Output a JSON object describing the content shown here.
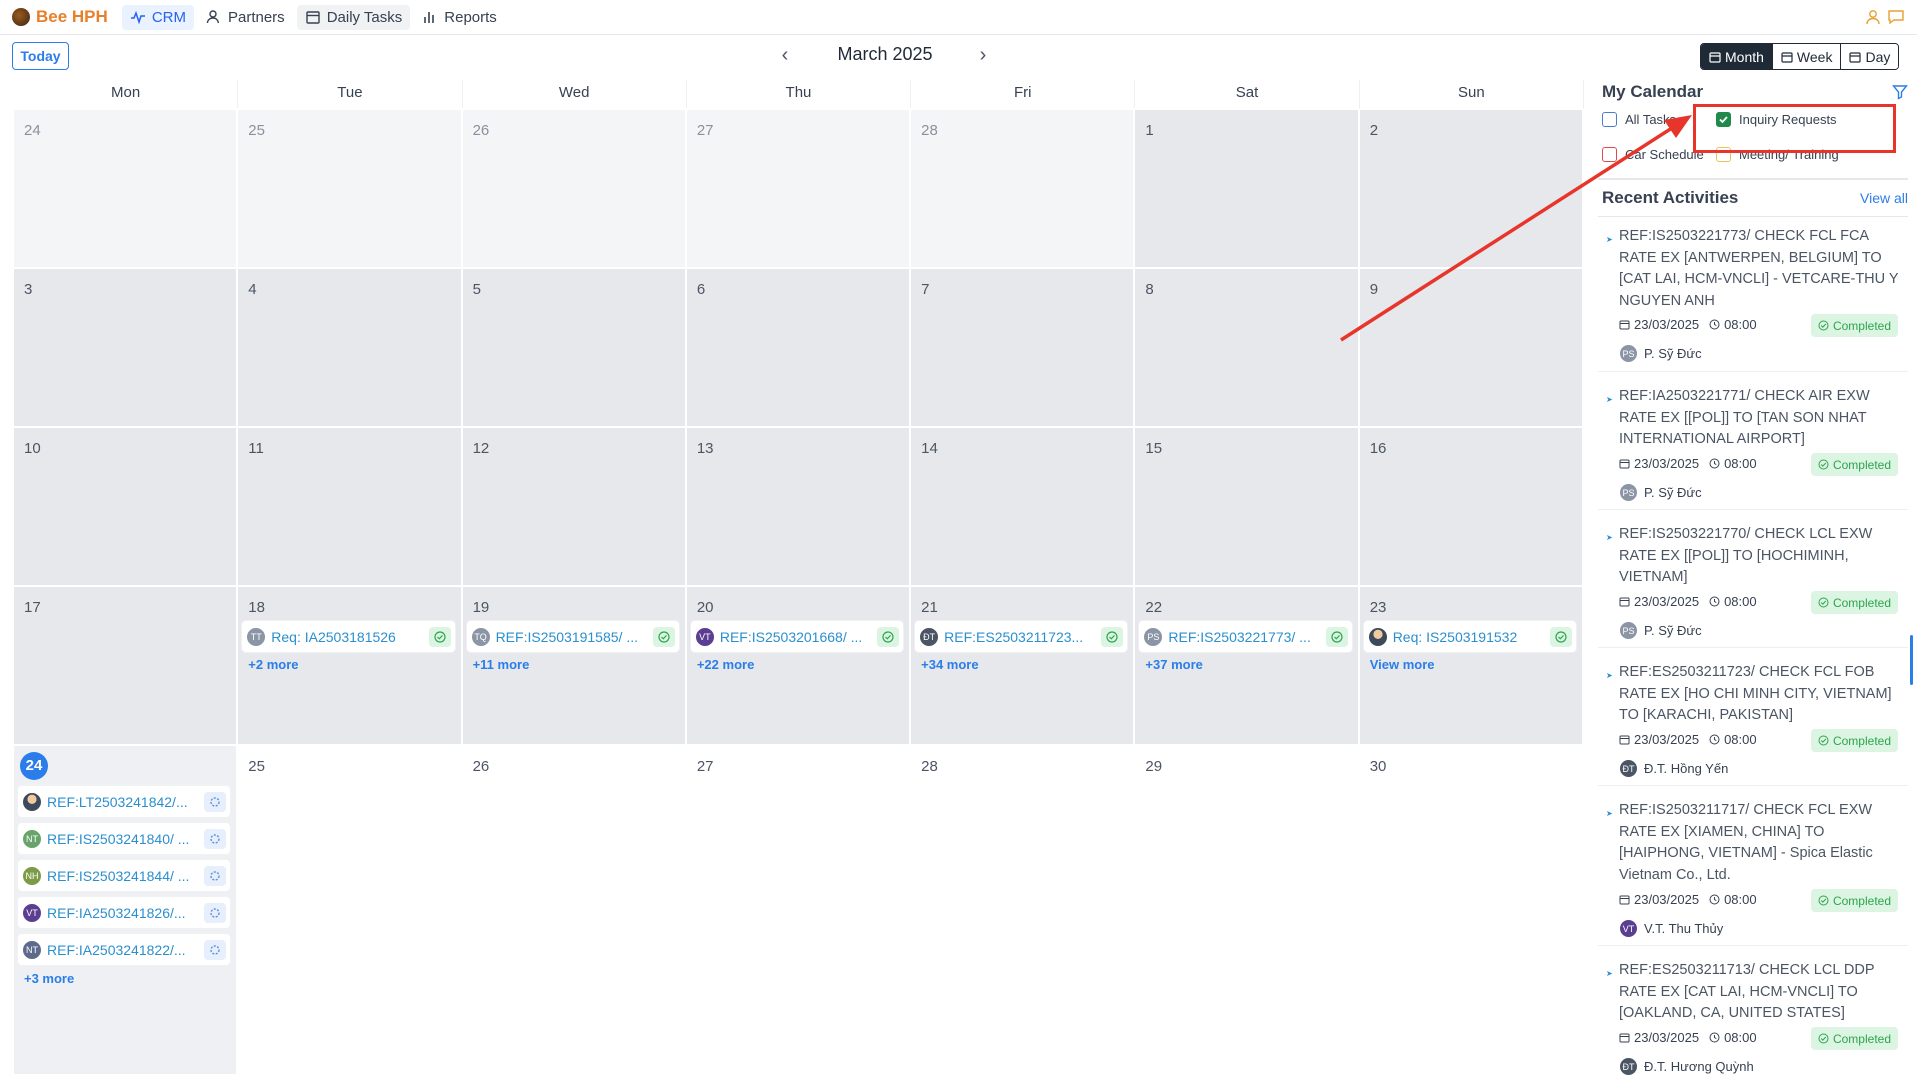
{
  "nav": {
    "brand": "Bee HPH",
    "items": [
      {
        "label": "CRM",
        "icon": "pulse-icon"
      },
      {
        "label": "Partners",
        "icon": "user-icon"
      },
      {
        "label": "Daily Tasks",
        "icon": "calendar-icon"
      },
      {
        "label": "Reports",
        "icon": "bar-chart-icon"
      }
    ]
  },
  "toolbar": {
    "today_label": "Today",
    "month_title": "March 2025",
    "prev_icon": "‹",
    "next_icon": "›",
    "views": [
      "Month",
      "Week",
      "Day"
    ],
    "active_view": "Month"
  },
  "calendar": {
    "days_of_week": [
      "Mon",
      "Tue",
      "Wed",
      "Thu",
      "Fri",
      "Sat",
      "Sun"
    ],
    "weeks": [
      {
        "days": [
          "24",
          "25",
          "26",
          "27",
          "28",
          "1",
          "2"
        ]
      },
      {
        "days": [
          "3",
          "4",
          "5",
          "6",
          "7",
          "8",
          "9"
        ]
      },
      {
        "days": [
          "10",
          "11",
          "12",
          "13",
          "14",
          "15",
          "16"
        ]
      },
      {
        "days": [
          "17",
          "18",
          "19",
          "20",
          "21",
          "22",
          "23"
        ]
      },
      {
        "days": [
          "24",
          "25",
          "26",
          "27",
          "28",
          "29",
          "30"
        ]
      }
    ],
    "week4_events": [
      {
        "avatar": "TT",
        "text": "Req: IA2503181526",
        "more": "+2 more"
      },
      {
        "avatar": "TQ",
        "text": "REF:IS2503191585/ ...",
        "more": "+11 more"
      },
      {
        "avatar": "VT",
        "text": "REF:IS2503201668/ ...",
        "more": "+22 more"
      },
      {
        "avatar": "ĐT",
        "text": "REF:ES2503211723...",
        "more": "+34 more"
      },
      {
        "avatar": "PS",
        "text": "REF:IS2503221773/ ...",
        "more": "+37 more"
      },
      {
        "avatar": "",
        "text": "Req: IS2503191532",
        "more": "View more"
      }
    ],
    "today_events": [
      {
        "avatar": "",
        "text": "REF:LT2503241842/..."
      },
      {
        "avatar": "NT",
        "text": "REF:IS2503241840/ ..."
      },
      {
        "avatar": "NH",
        "text": "REF:IS2503241844/ ..."
      },
      {
        "avatar": "VT",
        "text": "REF:IA2503241826/..."
      },
      {
        "avatar": "NT",
        "text": "REF:IA2503241822/..."
      }
    ],
    "today_more": "+3 more"
  },
  "sidebar": {
    "my_calendar_title": "My Calendar",
    "filters": [
      {
        "label": "All Tasks",
        "checked": false
      },
      {
        "label": "Inquiry Requests",
        "checked": true
      },
      {
        "label": "Car Schedule",
        "checked": false
      },
      {
        "label": "Meeting/ Training",
        "checked": false
      }
    ],
    "recent_title": "Recent Activities",
    "view_all": "View all",
    "activities": [
      {
        "title": "REF:IS2503221773/ CHECK FCL FCA RATE EX [ANTWERPEN, BELGIUM] TO [CAT LAI, HCM-VNCLI] - VETCARE-THU Y NGUYEN ANH",
        "date": "23/03/2025",
        "time": "08:00",
        "status": "Completed",
        "avatar": "PS",
        "user": "P. Sỹ Đức"
      },
      {
        "title": "REF:IA2503221771/ CHECK AIR EXW RATE EX [[POL]] TO [TAN SON NHAT INTERNATIONAL AIRPORT]",
        "date": "23/03/2025",
        "time": "08:00",
        "status": "Completed",
        "avatar": "PS",
        "user": "P. Sỹ Đức"
      },
      {
        "title": "REF:IS2503221770/ CHECK LCL EXW RATE EX [[POL]] TO [HOCHIMINH, VIETNAM]",
        "date": "23/03/2025",
        "time": "08:00",
        "status": "Completed",
        "avatar": "PS",
        "user": "P. Sỹ Đức"
      },
      {
        "title": "REF:ES2503211723/ CHECK FCL FOB RATE EX [HO CHI MINH CITY, VIETNAM] TO [KARACHI, PAKISTAN]",
        "date": "23/03/2025",
        "time": "08:00",
        "status": "Completed",
        "avatar": "ĐT",
        "user": "Đ.T. Hồng Yến"
      },
      {
        "title": "REF:IS2503211717/ CHECK FCL EXW RATE EX [XIAMEN, CHINA] TO [HAIPHONG, VIETNAM] - Spica Elastic Vietnam Co., Ltd.",
        "date": "23/03/2025",
        "time": "08:00",
        "status": "Completed",
        "avatar": "VT",
        "user": "V.T. Thu Thủy"
      },
      {
        "title": "REF:ES2503211713/ CHECK LCL DDP RATE EX [CAT LAI, HCM-VNCLI] TO [OAKLAND, CA, UNITED STATES]",
        "date": "23/03/2025",
        "time": "08:00",
        "status": "Completed",
        "avatar": "ĐT",
        "user": "Đ.T. Hương Quỳnh"
      }
    ]
  },
  "colors": {
    "brand": "#e8802a",
    "accent": "#2b7de9",
    "completed": "#2da44e",
    "annotation": "#e8352b"
  }
}
